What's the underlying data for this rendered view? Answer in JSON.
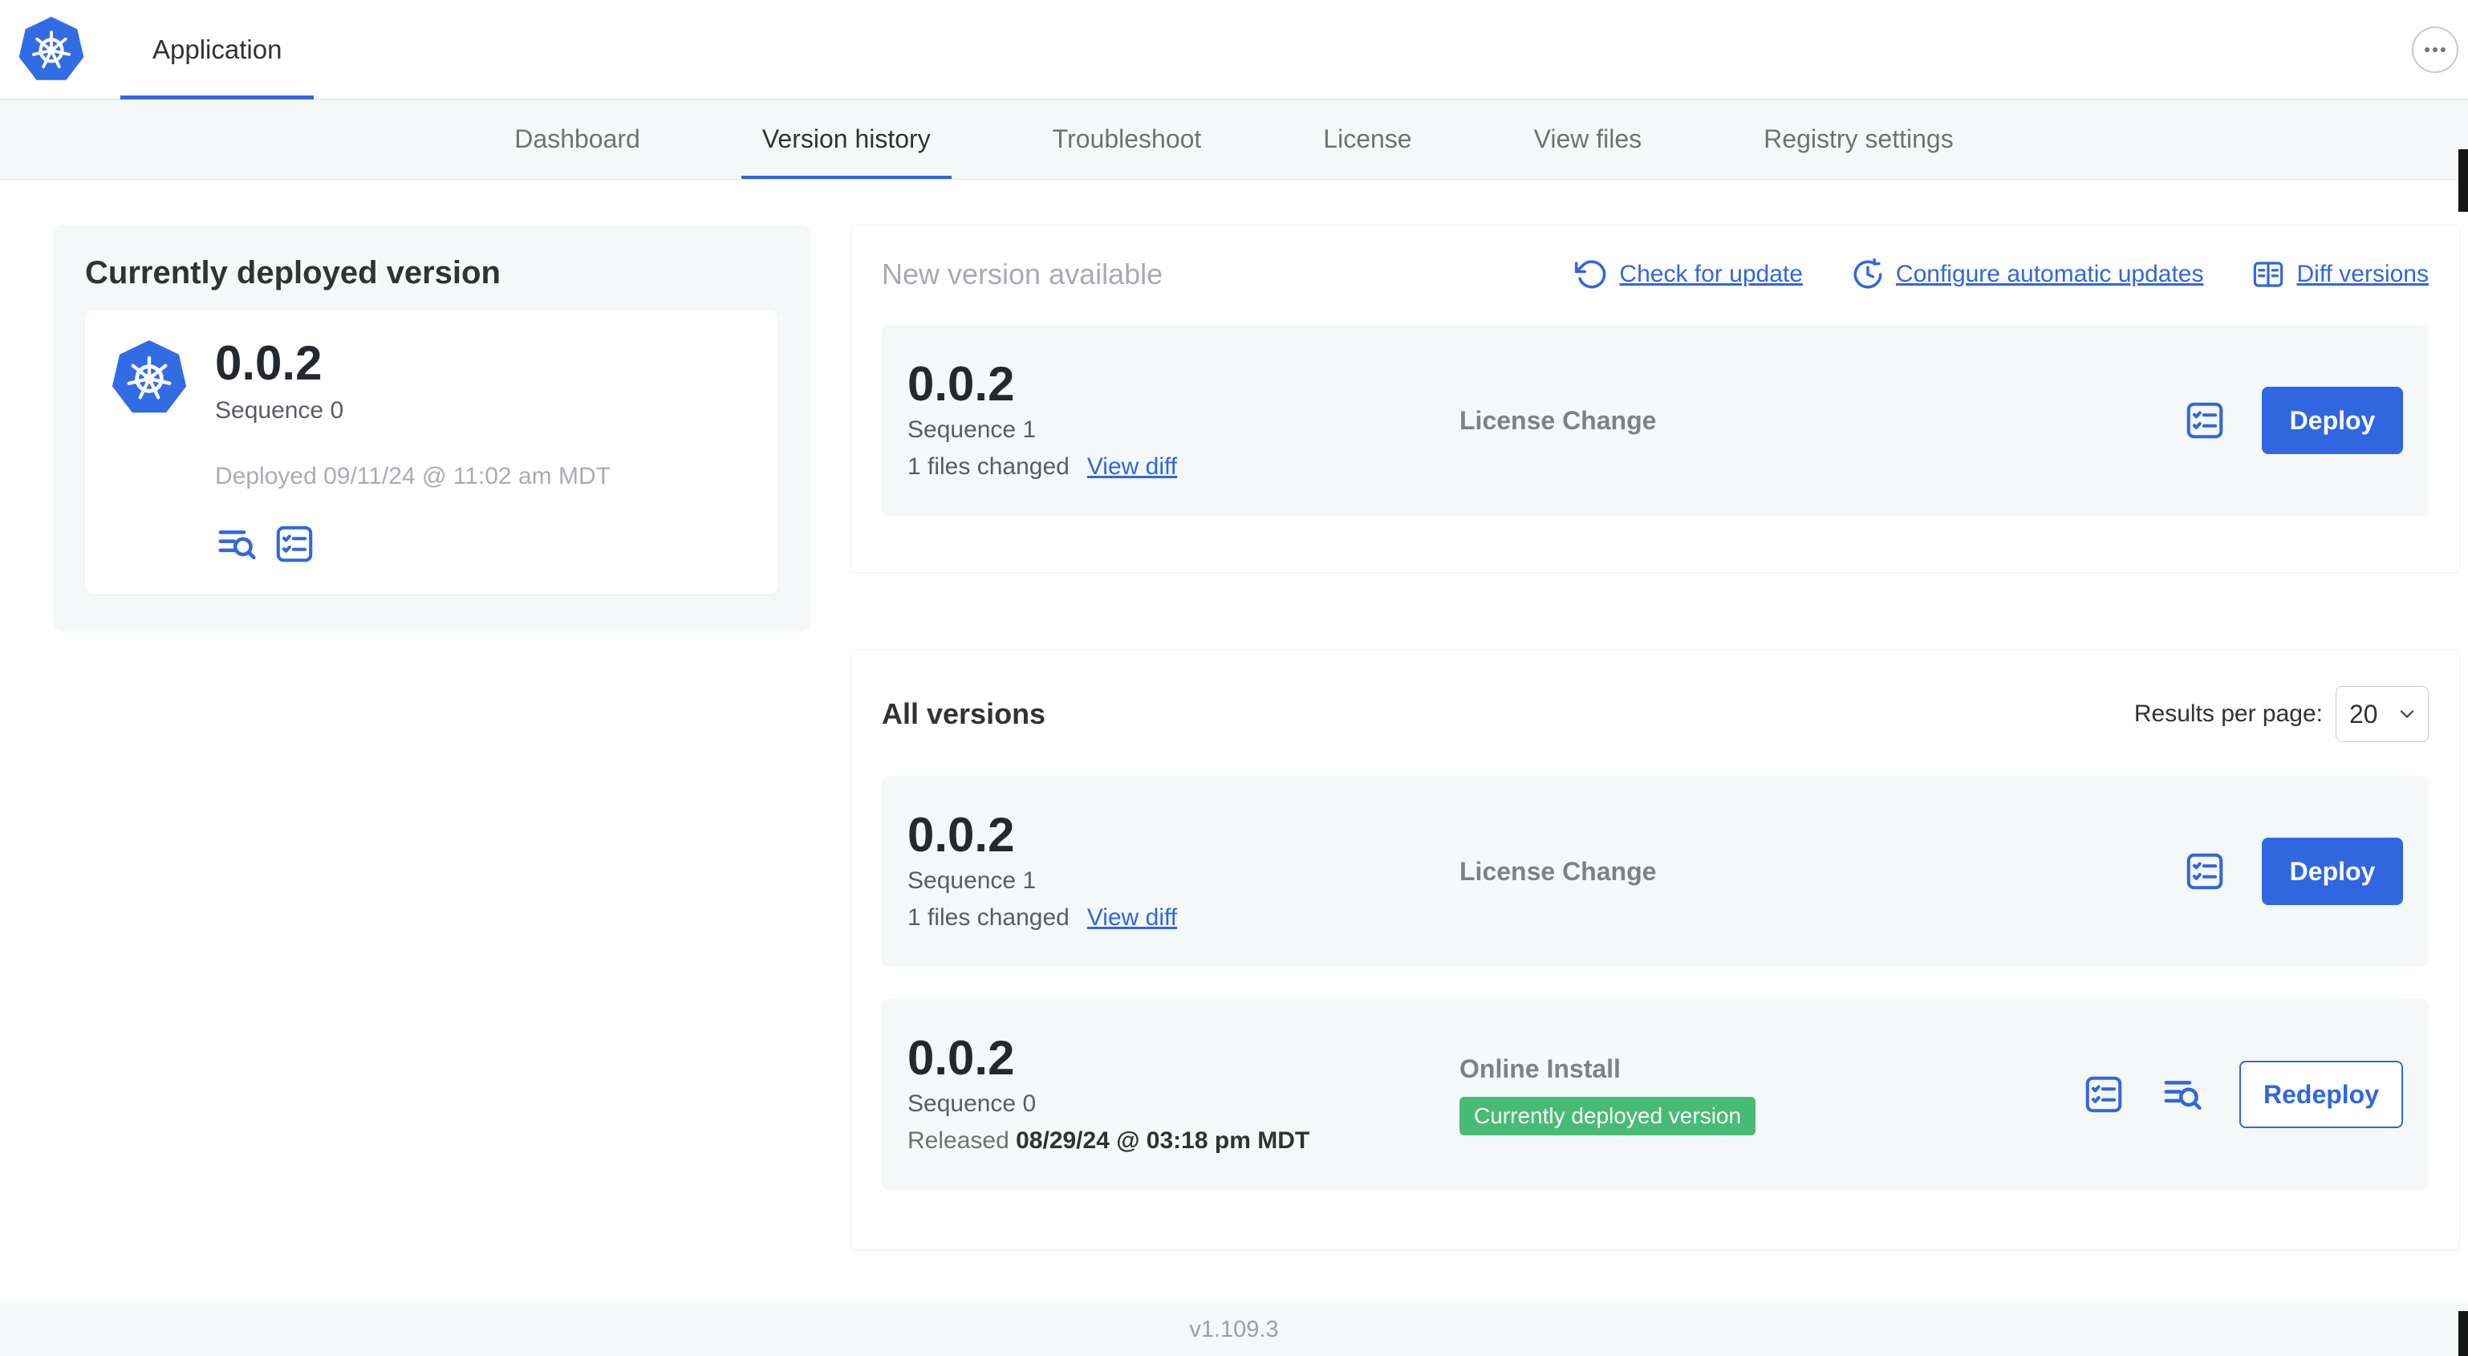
{
  "header": {
    "app_tab": "Application"
  },
  "nav": {
    "tabs": [
      {
        "label": "Dashboard",
        "active": false
      },
      {
        "label": "Version history",
        "active": true
      },
      {
        "label": "Troubleshoot",
        "active": false
      },
      {
        "label": "License",
        "active": false
      },
      {
        "label": "View files",
        "active": false
      },
      {
        "label": "Registry settings",
        "active": false
      }
    ]
  },
  "current_version": {
    "heading": "Currently deployed version",
    "version": "0.0.2",
    "sequence": "Sequence 0",
    "deployed": "Deployed 09/11/24 @ 11:02 am MDT"
  },
  "new_version": {
    "heading": "New version available",
    "check_for_update": "Check for update",
    "configure_updates": "Configure automatic updates",
    "diff_versions": "Diff versions",
    "row": {
      "version": "0.0.2",
      "sequence": "Sequence 1",
      "files_changed": "1 files changed",
      "view_diff": "View diff",
      "source": "License Change",
      "deploy": "Deploy"
    }
  },
  "all_versions": {
    "heading": "All versions",
    "results_per_page_label": "Results per page:",
    "results_per_page": "20",
    "rows": [
      {
        "version": "0.0.2",
        "sequence": "Sequence 1",
        "files_changed": "1 files changed",
        "view_diff": "View diff",
        "source": "License Change",
        "action": "Deploy"
      },
      {
        "version": "0.0.2",
        "sequence": "Sequence 0",
        "released_prefix": "Released",
        "released_date": "08/29/24 @ 03:18 pm MDT",
        "source": "Online Install",
        "badge": "Currently deployed version",
        "action": "Redeploy"
      }
    ]
  },
  "footer": {
    "version": "v1.109.3"
  },
  "colors": {
    "primary_blue": "#3066e0",
    "k8s_logo_blue": "#326ce5",
    "badge_green": "#47bb74",
    "card_gray": "#f5f8f9"
  },
  "icons": {
    "app_logo": "kubernetes-helm-wheel-icon",
    "more": "ellipsis-icon",
    "check_for_update": "rotate-ccw-icon",
    "configure_updates": "clock-refresh-icon",
    "diff_versions": "split-diff-icon",
    "view_logs": "lines-magnifier-icon",
    "preflight_checks": "checklist-icon",
    "select_chevron": "chevron-down-icon"
  }
}
